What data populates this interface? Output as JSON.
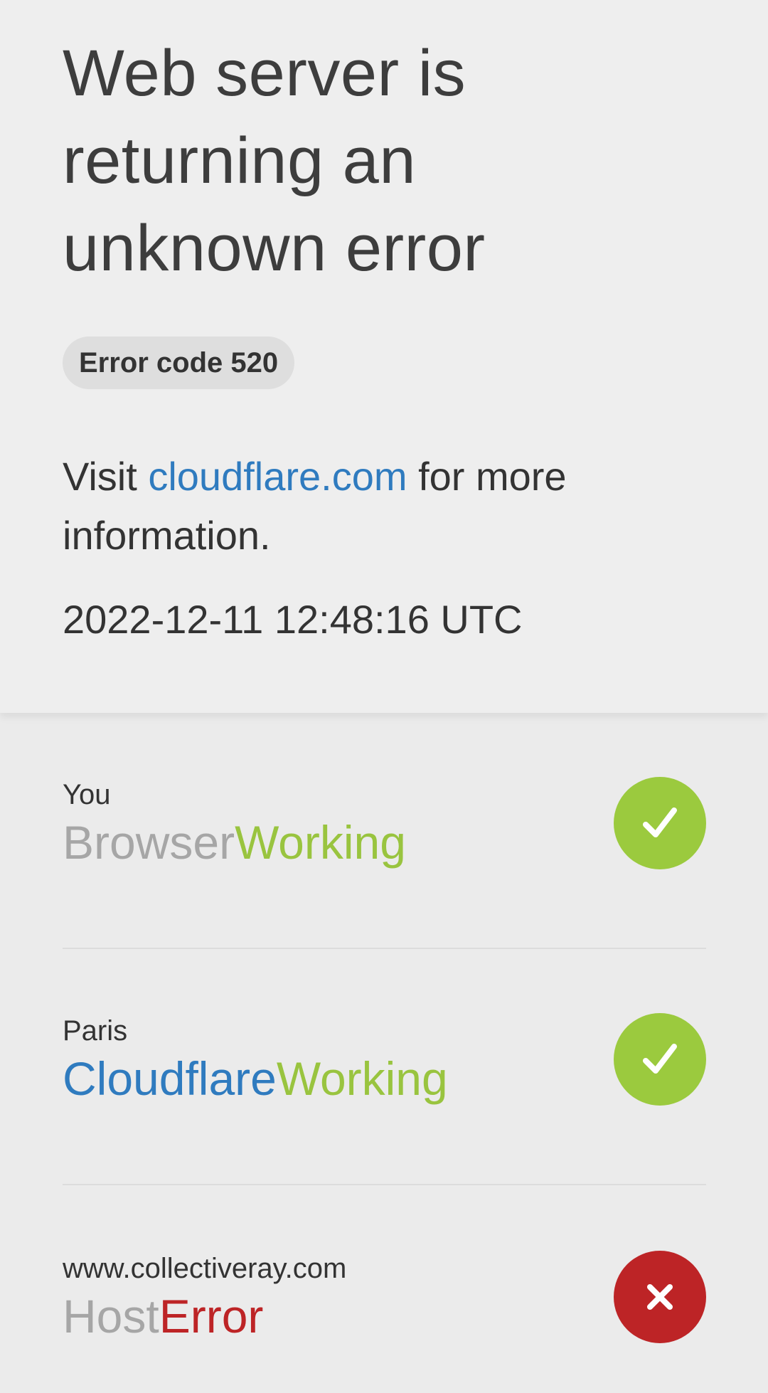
{
  "header": {
    "title": "Web server is returning an unknown error",
    "error_code": "Error code 520",
    "visit_prefix": "Visit ",
    "visit_link": "cloudflare.com",
    "visit_suffix": " for more information.",
    "timestamp": "2022-12-11 12:48:16 UTC"
  },
  "status": [
    {
      "location": "You",
      "component": "Browser",
      "state": "Working",
      "icon": "check-icon",
      "status_color": "#9bca3e"
    },
    {
      "location": "Paris",
      "component": "Cloudflare",
      "state": "Working",
      "icon": "check-icon",
      "status_color": "#9bca3e"
    },
    {
      "location": "www.collectiveray.com",
      "component": "Host",
      "state": "Error",
      "icon": "close-icon",
      "status_color": "#bd2426"
    }
  ],
  "colors": {
    "link": "#2f7bbf",
    "working": "#9bca3e",
    "error": "#bd2426"
  }
}
